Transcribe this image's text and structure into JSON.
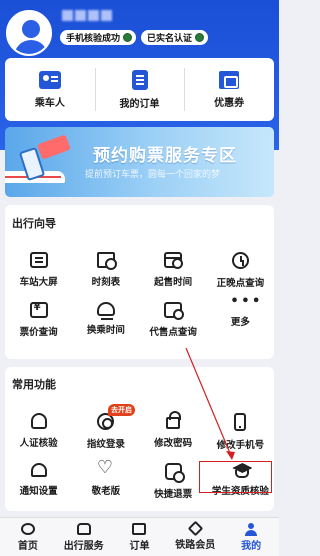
{
  "profile": {
    "username_masked": "",
    "badges": [
      "手机核验成功",
      "已实名认证"
    ]
  },
  "quick_actions": [
    {
      "label": "乘车人",
      "icon": "passenger-card-icon"
    },
    {
      "label": "我的订单",
      "icon": "order-document-icon"
    },
    {
      "label": "优惠券",
      "icon": "coupon-icon"
    }
  ],
  "banner": {
    "title": "预约购票服务专区",
    "subtitle": "提前预订车票，圆每一个回家的梦"
  },
  "travel_guide": {
    "title": "出行向导",
    "items": [
      {
        "label": "车站大屏",
        "icon": "station-screen-icon"
      },
      {
        "label": "时刻表",
        "icon": "timetable-icon"
      },
      {
        "label": "起售时间",
        "icon": "sale-time-icon"
      },
      {
        "label": "正晚点查询",
        "icon": "clock-icon"
      },
      {
        "label": "票价查询",
        "icon": "price-icon"
      },
      {
        "label": "换乘时间",
        "icon": "transfer-icon"
      },
      {
        "label": "代售点查询",
        "icon": "agent-search-icon"
      },
      {
        "label": "更多",
        "icon": "more-icon"
      }
    ]
  },
  "common_functions": {
    "title": "常用功能",
    "new_tag": "去开启",
    "items": [
      {
        "label": "人证核验",
        "icon": "person-verify-icon"
      },
      {
        "label": "指纹登录",
        "icon": "fingerprint-icon"
      },
      {
        "label": "修改密码",
        "icon": "lock-icon"
      },
      {
        "label": "修改手机号",
        "icon": "mobile-icon"
      },
      {
        "label": "通知设置",
        "icon": "bell-icon"
      },
      {
        "label": "敬老版",
        "icon": "heart-icon"
      },
      {
        "label": "快捷退票",
        "icon": "refund-icon"
      },
      {
        "label": "学生资质核验",
        "icon": "graduation-cap-icon"
      }
    ]
  },
  "tabbar": [
    {
      "label": "首页",
      "icon": "home-icon",
      "active": false
    },
    {
      "label": "出行服务",
      "icon": "train-icon",
      "active": false
    },
    {
      "label": "订单",
      "icon": "order-icon",
      "active": false
    },
    {
      "label": "铁路会员",
      "icon": "vip-icon",
      "active": false
    },
    {
      "label": "我的",
      "icon": "me-icon",
      "active": true
    }
  ],
  "colors": {
    "primary": "#2456d8",
    "header": "#1a4fd6",
    "highlight_box": "#d42020",
    "new_tag": "#e0401a"
  }
}
